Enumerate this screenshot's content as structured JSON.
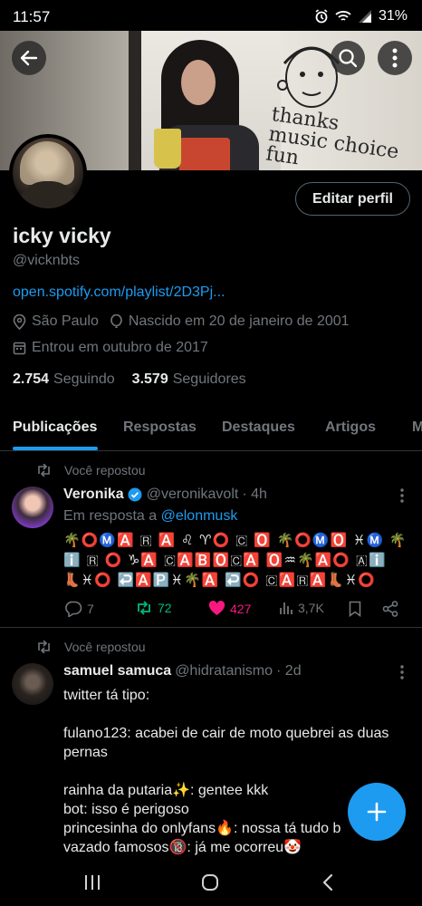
{
  "status_bar": {
    "time": "11:57",
    "battery": "31%",
    "icons": [
      "alarm-icon",
      "wifi-icon",
      "signal-icon"
    ]
  },
  "header": {
    "back_icon": "arrow-left-icon",
    "search_icon": "search-icon",
    "more_icon": "more-vertical-icon"
  },
  "profile": {
    "edit_button": "Editar perfil",
    "name": "icky vicky",
    "handle": "@vicknbts",
    "link": "open.spotify.com/playlist/2D3Pj...",
    "location": "São Paulo",
    "birthday": "Nascido em 20 de janeiro de 2001",
    "joined": "Entrou em outubro de 2017",
    "following_count": "2.754",
    "following_label": "Seguindo",
    "followers_count": "3.579",
    "followers_label": "Seguidores"
  },
  "banner": {
    "doodle_text": [
      "thanks",
      "music choice",
      "fun"
    ]
  },
  "tabs": [
    {
      "label": "Publicações",
      "active": true
    },
    {
      "label": "Respostas",
      "active": false
    },
    {
      "label": "Destaques",
      "active": false
    },
    {
      "label": "Artigos",
      "active": false
    },
    {
      "label": "M",
      "active": false
    }
  ],
  "posts": [
    {
      "repost_label": "Você repostou",
      "name": "Veronika",
      "verified": true,
      "handle": "@veronikavolt",
      "time": "· 4h",
      "reply_prefix": "Em resposta a",
      "reply_handle": "@elonmusk",
      "lines": [
        "🌴⭕Ⓜ️🅰️ 🇷 🅰️ ♌ ♈⭕ 🇨 🅾️ 🌴⭕Ⓜ️🅾️ ♓Ⓜ️ 🌴",
        "ℹ️ 🇷 ⭕ ♑🅰️ 🇨🅰️🅱️🅾️🇨🅰️ 🅾️♒🌴🅰️⭕ 🇦ℹ️",
        "👢♓⭕ ↩️🅰️🅿️♓🌴🅰️ ↩️⭕ 🇨🅰️🇷🅰️👢♓⭕"
      ],
      "stats": {
        "replies": "7",
        "reposts": "72",
        "likes": "427",
        "views": "3,7K"
      }
    },
    {
      "repost_label": "Você repostou",
      "name": "samuel samuca",
      "verified": false,
      "handle": "@hidratanismo",
      "time": "· 2d",
      "lines": [
        "twitter tá tipo:",
        "",
        "fulano123: acabei de cair de moto quebrei as duas",
        "pernas",
        "",
        "rainha da putaria✨: gentee kkk",
        "bot: isso é perigoso",
        "princesinha do onlyfans🔥:  nossa tá tudo b",
        "vazado famosos🔞: já me ocorreu🤡"
      ]
    }
  ],
  "fab_icon": "plus-icon",
  "nav": [
    "recent-apps-icon",
    "home-icon",
    "back-icon"
  ],
  "colors": {
    "accent": "#1d9bf0",
    "background": "#000000",
    "muted": "#71767b",
    "text": "#e7e9ea",
    "repost_green": "#00ba7c",
    "like_pink": "#f91880"
  }
}
